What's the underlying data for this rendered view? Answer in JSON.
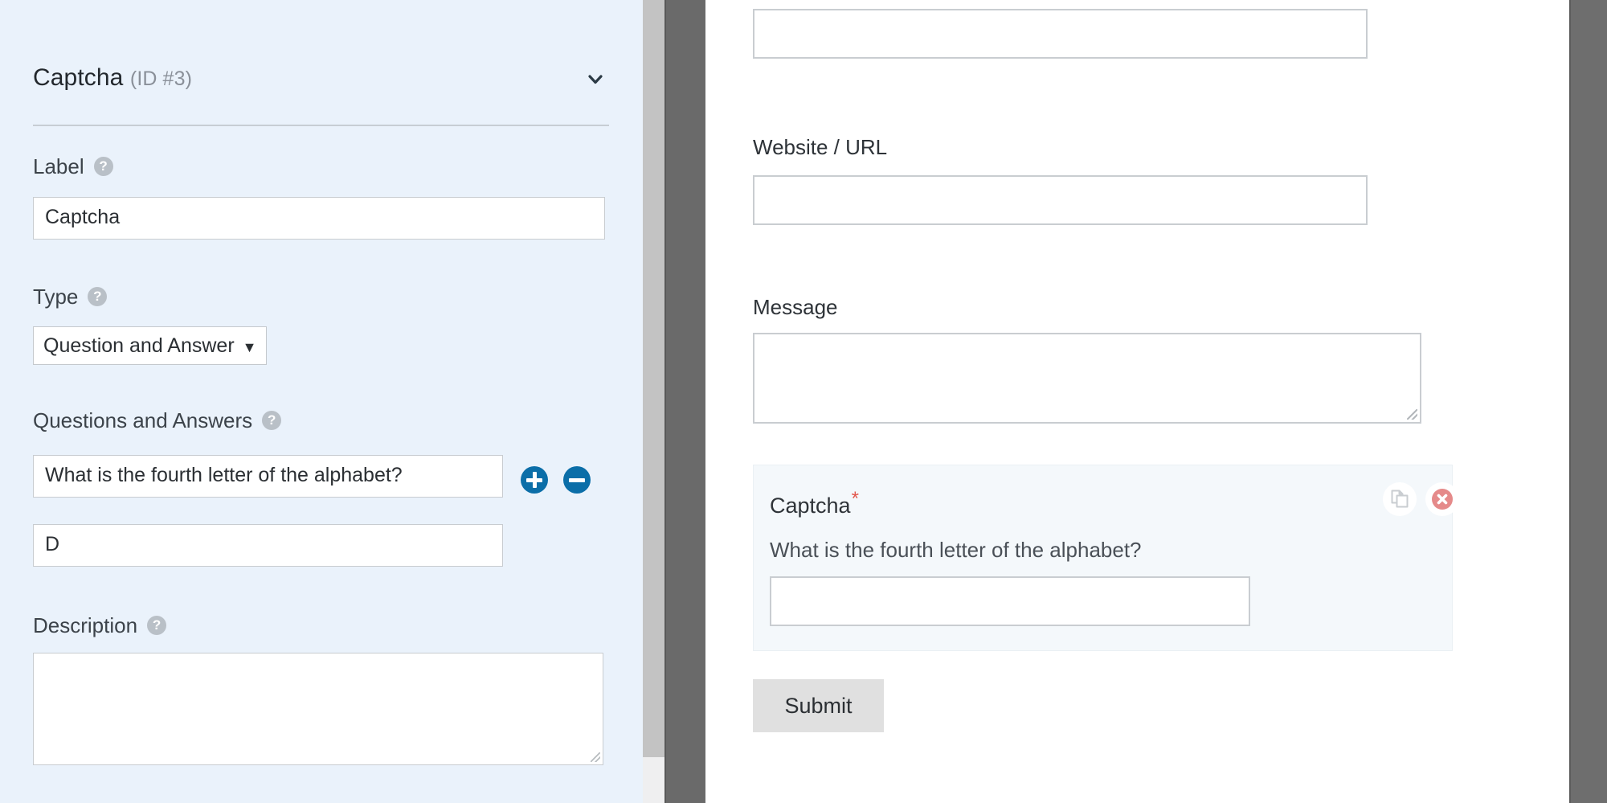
{
  "sidebar": {
    "panel": {
      "title": "Captcha",
      "id_tag": "(ID #3)",
      "collapse_icon": "chevron-down-icon"
    },
    "fields": {
      "label": {
        "label": "Label",
        "help_icon": "help-circle-icon",
        "value": "Captcha"
      },
      "type": {
        "label": "Type",
        "help_icon": "help-circle-icon",
        "value": "Question and Answer",
        "caret": "▼"
      },
      "questions_answers": {
        "label": "Questions and Answers",
        "help_icon": "help-circle-icon",
        "question_value": "What is the fourth letter of the alphabet?",
        "answer_value": "D",
        "add_icon": "plus-circle-icon",
        "remove_icon": "minus-circle-icon"
      },
      "description": {
        "label": "Description",
        "help_icon": "help-circle-icon",
        "value": ""
      }
    }
  },
  "preview": {
    "fields": [
      {
        "label": "",
        "value": ""
      },
      {
        "label": "Website / URL",
        "value": ""
      },
      {
        "label": "Message",
        "value": ""
      }
    ],
    "captcha_block": {
      "title": "Captcha",
      "required_mark": "*",
      "question": "What is the fourth letter of the alphabet?",
      "answer_value": "",
      "duplicate_icon": "copy-pages-icon",
      "delete_icon": "delete-circle-icon"
    },
    "submit_label": "Submit"
  },
  "colors": {
    "sidebar_bg": "#eaf2fb",
    "accent_blue": "#0b6ea8",
    "required_red": "#e2574c",
    "delete_red": "#e58a8a",
    "captcha_block_bg": "#f4f8fb",
    "gutter_gray": "#6a6a6a",
    "submit_bg": "#e0e0e0"
  }
}
